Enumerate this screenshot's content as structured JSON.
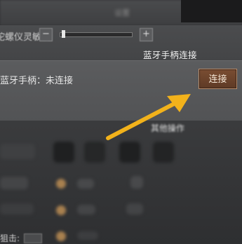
{
  "header": {
    "title_blurred": "设置"
  },
  "sensitivity": {
    "label": "陀螺仪灵敏度",
    "minus": "−",
    "plus": "+"
  },
  "bluetooth": {
    "section_title": "蓝牙手柄连接",
    "status_label": "蓝牙手柄：未连接",
    "connect_button": "连接"
  },
  "other_ops": {
    "title": "其他操作"
  },
  "bottom": {
    "label": "狙击:"
  },
  "colors": {
    "connect_button_bg": "#6b4430",
    "arrow": "#f2b21b"
  }
}
